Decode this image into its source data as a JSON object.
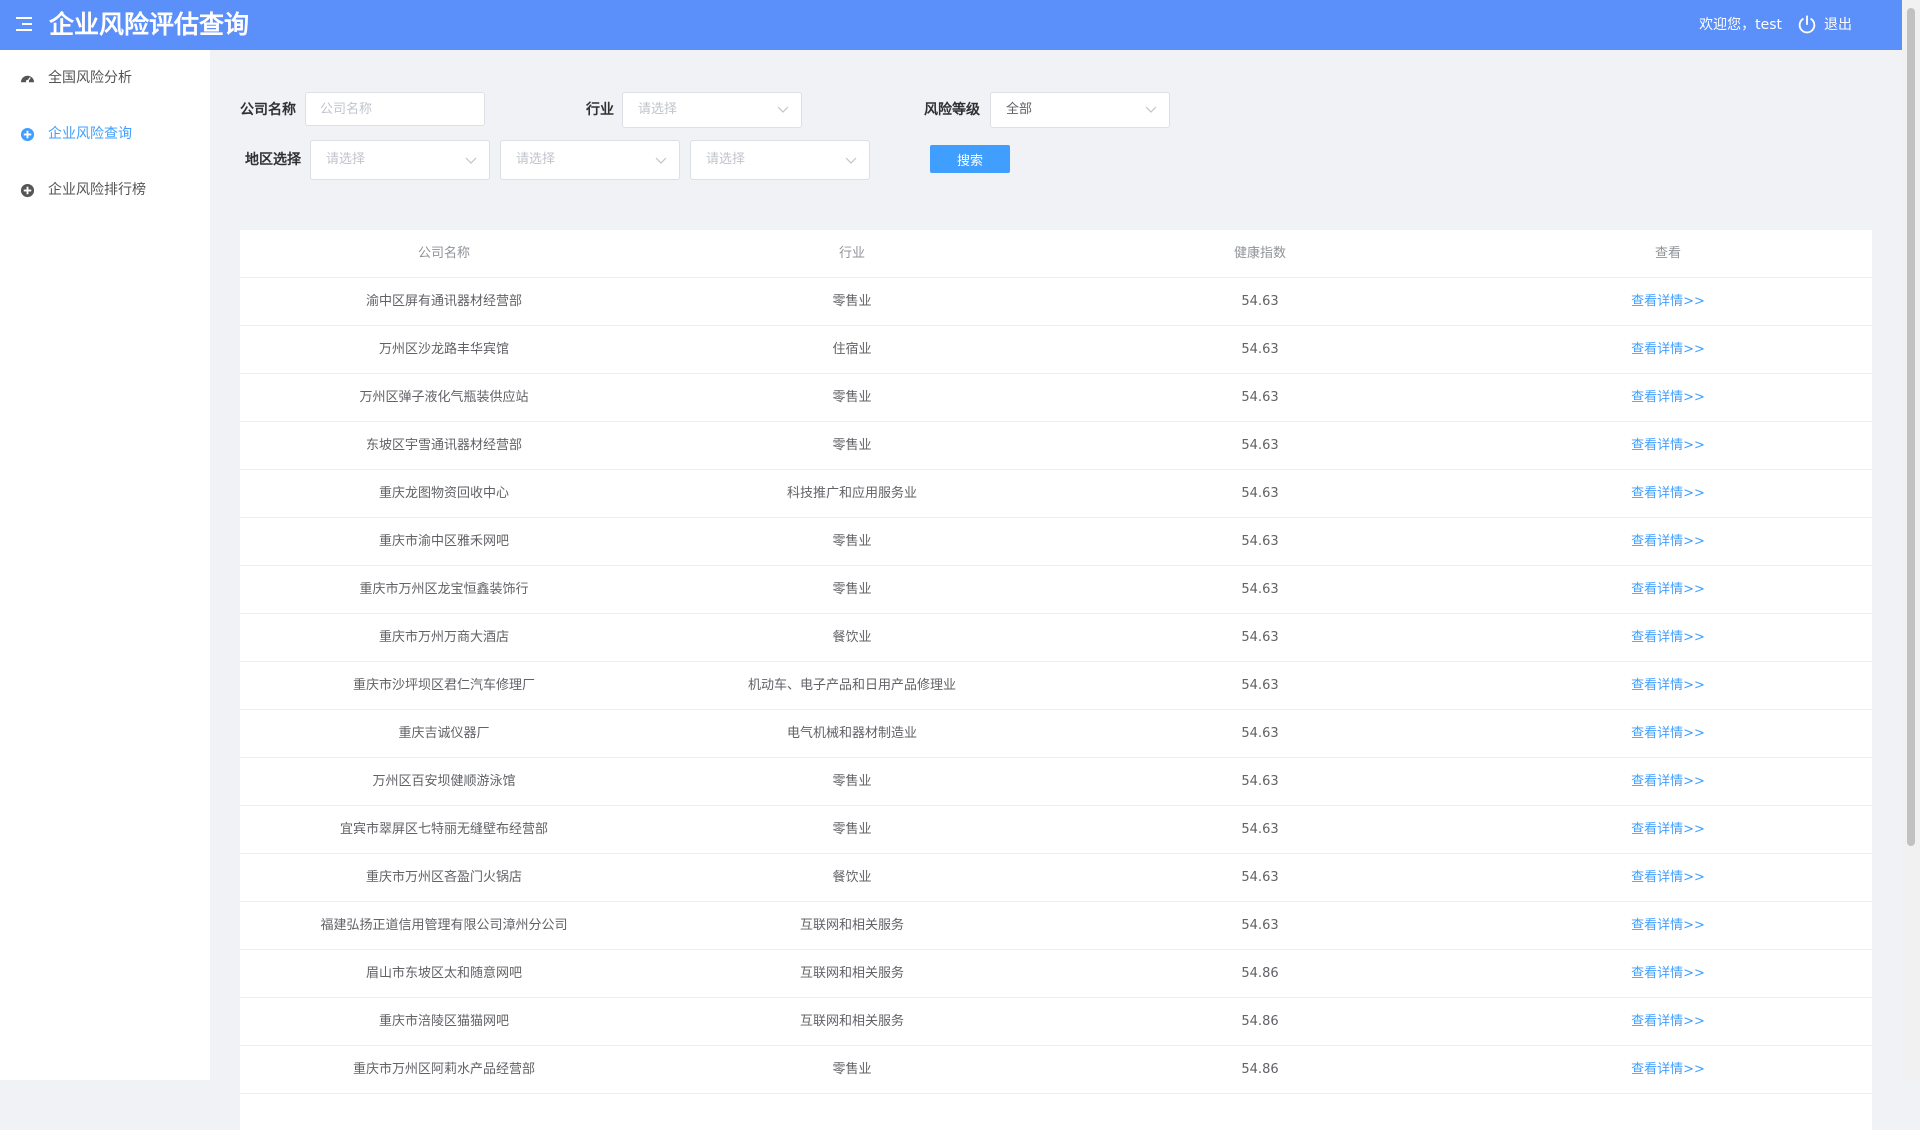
{
  "header": {
    "title": "企业风险评估查询",
    "welcome": "欢迎您，test",
    "logout_label": "退出",
    "menu_icon": "menu-fold-icon",
    "logout_icon": "power-icon",
    "background_color": "#5b8ff9"
  },
  "sidebar": {
    "items": [
      {
        "label": "全国风险分析",
        "icon": "dashboard-icon",
        "active": false
      },
      {
        "label": "企业风险查询",
        "icon": "plus-circle-icon",
        "active": true
      },
      {
        "label": "企业风险排行榜",
        "icon": "plus-circle-icon",
        "active": false
      }
    ],
    "active_color": "#409eff"
  },
  "filters": {
    "company_label": "公司名称",
    "company_placeholder": "公司名称",
    "company_value": "",
    "industry_label": "行业",
    "industry_value": "请选择",
    "risk_label": "风险等级",
    "risk_value": "全部",
    "region_label": "地区选择",
    "region_values": [
      "请选择",
      "请选择",
      "请选择"
    ],
    "search_label": "搜索"
  },
  "table": {
    "columns": [
      "公司名称",
      "行业",
      "健康指数",
      "查看"
    ],
    "link_label": "查看详情>>",
    "rows": [
      {
        "company": "渝中区屏有通讯器材经营部",
        "industry": "零售业",
        "score": "54.63"
      },
      {
        "company": "万州区沙龙路丰华宾馆",
        "industry": "住宿业",
        "score": "54.63"
      },
      {
        "company": "万州区弹子液化气瓶装供应站",
        "industry": "零售业",
        "score": "54.63"
      },
      {
        "company": "东坡区宇雪通讯器材经营部",
        "industry": "零售业",
        "score": "54.63"
      },
      {
        "company": "重庆龙图物资回收中心",
        "industry": "科技推广和应用服务业",
        "score": "54.63"
      },
      {
        "company": "重庆市渝中区雅禾网吧",
        "industry": "零售业",
        "score": "54.63"
      },
      {
        "company": "重庆市万州区龙宝恒鑫装饰行",
        "industry": "零售业",
        "score": "54.63"
      },
      {
        "company": "重庆市万州万商大酒店",
        "industry": "餐饮业",
        "score": "54.63"
      },
      {
        "company": "重庆市沙坪坝区君仁汽车修理厂",
        "industry": "机动车、电子产品和日用产品修理业",
        "score": "54.63"
      },
      {
        "company": "重庆吉诚仪器厂",
        "industry": "电气机械和器材制造业",
        "score": "54.63"
      },
      {
        "company": "万州区百安坝健顺游泳馆",
        "industry": "零售业",
        "score": "54.63"
      },
      {
        "company": "宜宾市翠屏区七特丽无缝壁布经营部",
        "industry": "零售业",
        "score": "54.63"
      },
      {
        "company": "重庆市万州区吝盈门火锅店",
        "industry": "餐饮业",
        "score": "54.63"
      },
      {
        "company": "福建弘扬正道信用管理有限公司漳州分公司",
        "industry": "互联网和相关服务",
        "score": "54.63"
      },
      {
        "company": "眉山市东坡区太和随意网吧",
        "industry": "互联网和相关服务",
        "score": "54.86"
      },
      {
        "company": "重庆市涪陵区猫猫网吧",
        "industry": "互联网和相关服务",
        "score": "54.86"
      },
      {
        "company": "重庆市万州区阿莉水产品经营部",
        "industry": "零售业",
        "score": "54.86"
      }
    ]
  }
}
